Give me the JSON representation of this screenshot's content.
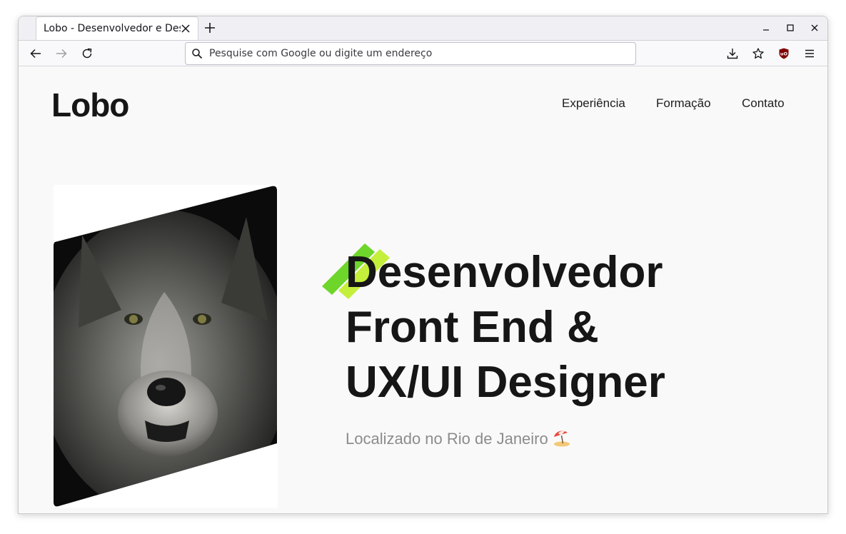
{
  "browser": {
    "tab_title": "Lobo - Desenvolvedor e Designer",
    "url_placeholder": "Pesquise com Google ou digite um endereço"
  },
  "site": {
    "logo": "Lobo",
    "nav": [
      "Experiência",
      "Formação",
      "Contato"
    ],
    "hero": {
      "headline_lines": [
        "Desenvolvedor",
        "Front End &",
        "UX/UI Designer"
      ],
      "location": "Localizado no Rio de Janeiro"
    }
  },
  "colors": {
    "stripe_dark": "#6ed52a",
    "stripe_light": "#c4ef3a",
    "text": "#161616",
    "muted": "#8c8c8c"
  },
  "icons": [
    "close-icon",
    "plus-icon",
    "back-arrow-icon",
    "forward-arrow-icon",
    "reload-icon",
    "search-icon",
    "download-icon",
    "extensions-icon",
    "ublock-shield-icon",
    "menu-icon",
    "beach-umbrella-icon"
  ]
}
